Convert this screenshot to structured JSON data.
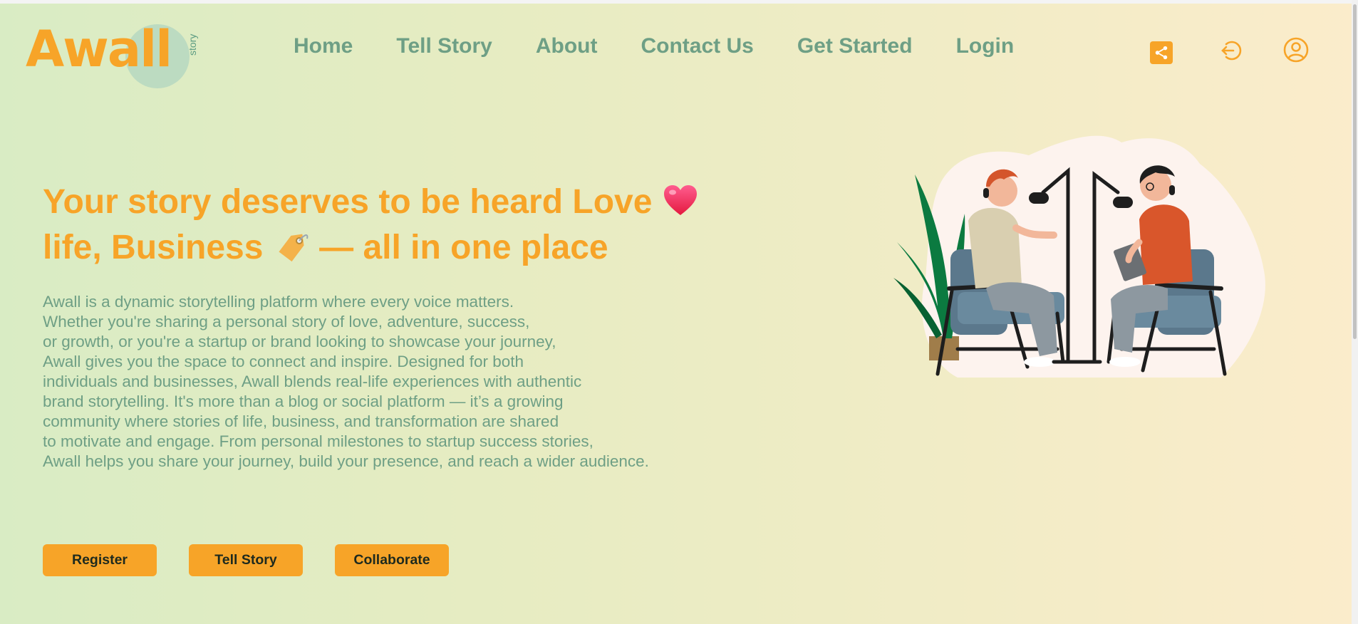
{
  "logo": {
    "word": "Awall",
    "tag": "story"
  },
  "nav": {
    "items": [
      "Home",
      "Tell Story",
      "About",
      "Contact Us",
      "Get Started",
      "Login"
    ]
  },
  "header_icons": [
    "share-icon",
    "logout-icon",
    "user-circle-icon"
  ],
  "hero": {
    "title_part1": "Your story deserves to be heard Love",
    "title_part2": "life, Business",
    "title_part3": " — all in one place",
    "description_lines": [
      "Awall is a dynamic storytelling platform where every voice matters.",
      "Whether you're sharing a personal story of love, adventure, success,",
      "or growth, or you're a startup or brand looking to showcase your journey,",
      "Awall gives you the space to connect and inspire. Designed for both",
      "individuals and businesses, Awall blends real-life experiences with authentic",
      "brand storytelling. It's more than a blog or social platform — it’s a growing",
      "community where stories of life, business, and transformation are shared",
      "to motivate and engage. From personal milestones to startup success stories,",
      "Awall helps you share your journey, build your presence, and reach a wider audience."
    ]
  },
  "buttons": {
    "register": "Register",
    "tell_story": "Tell Story",
    "collaborate": "Collaborate"
  },
  "colors": {
    "accent": "#f7a428",
    "text_green": "#6e9f85",
    "logo_circle": "#b6d8c1"
  }
}
